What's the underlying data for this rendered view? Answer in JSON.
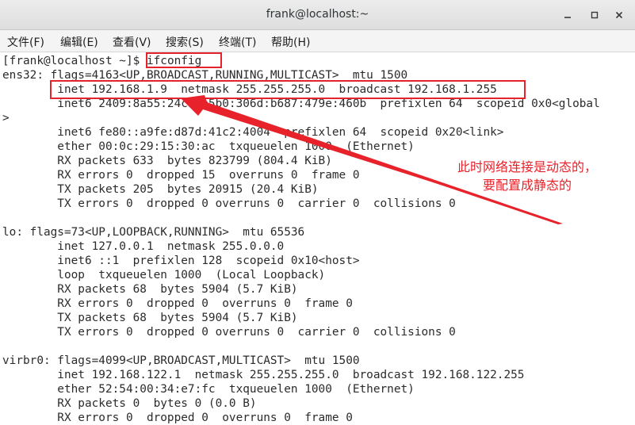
{
  "window": {
    "title": "frank@localhost:~",
    "minimize_icon": "minimize-icon",
    "maximize_icon": "maximize-icon",
    "close_icon": "close-icon"
  },
  "menu": {
    "items": [
      "文件(F)",
      "编辑(E)",
      "查看(V)",
      "搜索(S)",
      "终端(T)",
      "帮助(H)"
    ]
  },
  "terminal": {
    "prompt": "[frank@localhost ~]$ ",
    "command": "ifconfig",
    "lines": [
      "ens32: flags=4163<UP,BROADCAST,RUNNING,MULTICAST>  mtu 1500",
      "        inet 192.168.1.9  netmask 255.255.255.0  broadcast 192.168.1.255",
      "        inet6 2409:8a55:24cf:e5b0:306d:b687:479e:460b  prefixlen 64  scopeid 0x0<global",
      ">",
      "        inet6 fe80::a9fe:d87d:41c2:4004  prefixlen 64  scopeid 0x20<link>",
      "        ether 00:0c:29:15:30:ac  txqueuelen 1000  (Ethernet)",
      "        RX packets 633  bytes 823799 (804.4 KiB)",
      "        RX errors 0  dropped 15  overruns 0  frame 0",
      "        TX packets 205  bytes 20915 (20.4 KiB)",
      "        TX errors 0  dropped 0 overruns 0  carrier 0  collisions 0",
      "",
      "lo: flags=73<UP,LOOPBACK,RUNNING>  mtu 65536",
      "        inet 127.0.0.1  netmask 255.0.0.0",
      "        inet6 ::1  prefixlen 128  scopeid 0x10<host>",
      "        loop  txqueuelen 1000  (Local Loopback)",
      "        RX packets 68  bytes 5904 (5.7 KiB)",
      "        RX errors 0  dropped 0  overruns 0  frame 0",
      "        TX packets 68  bytes 5904 (5.7 KiB)",
      "        TX errors 0  dropped 0 overruns 0  carrier 0  collisions 0",
      "",
      "virbr0: flags=4099<UP,BROADCAST,MULTICAST>  mtu 1500",
      "        inet 192.168.122.1  netmask 255.255.255.0  broadcast 192.168.122.255",
      "        ether 52:54:00:34:e7:fc  txqueuelen 1000  (Ethernet)",
      "        RX packets 0  bytes 0 (0.0 B)",
      "        RX errors 0  dropped 0  overruns 0  frame 0"
    ]
  },
  "annotation": {
    "line1": "此时网络连接是动态的，",
    "line2": "要配置成静态的",
    "color": "#e8222a"
  }
}
